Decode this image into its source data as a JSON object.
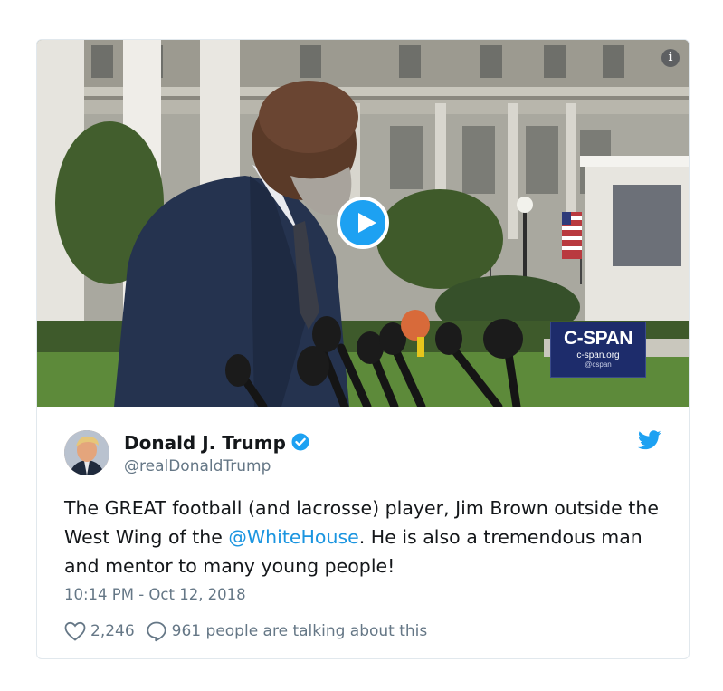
{
  "media": {
    "watermark_main": "C-SPAN",
    "watermark_url": "c-span.org",
    "watermark_handle": "@cspan",
    "info_icon": "info-icon",
    "play_icon": "play-icon"
  },
  "tweet": {
    "display_name": "Donald J. Trump",
    "handle": "@realDonaldTrump",
    "text_part1": "The GREAT football (and lacrosse) player, Jim Brown outside the West Wing of the ",
    "mention": "@WhiteHouse",
    "text_part2": ". He is also a tremendous man and mentor to many young people!",
    "timestamp": "10:14 PM - Oct 12, 2018",
    "likes": "2,246",
    "talking": "961 people are talking about this"
  },
  "colors": {
    "accent": "#1da1f2",
    "link": "#1b95e0",
    "muted": "#657786",
    "cspan_blue": "#1d2c6b"
  }
}
